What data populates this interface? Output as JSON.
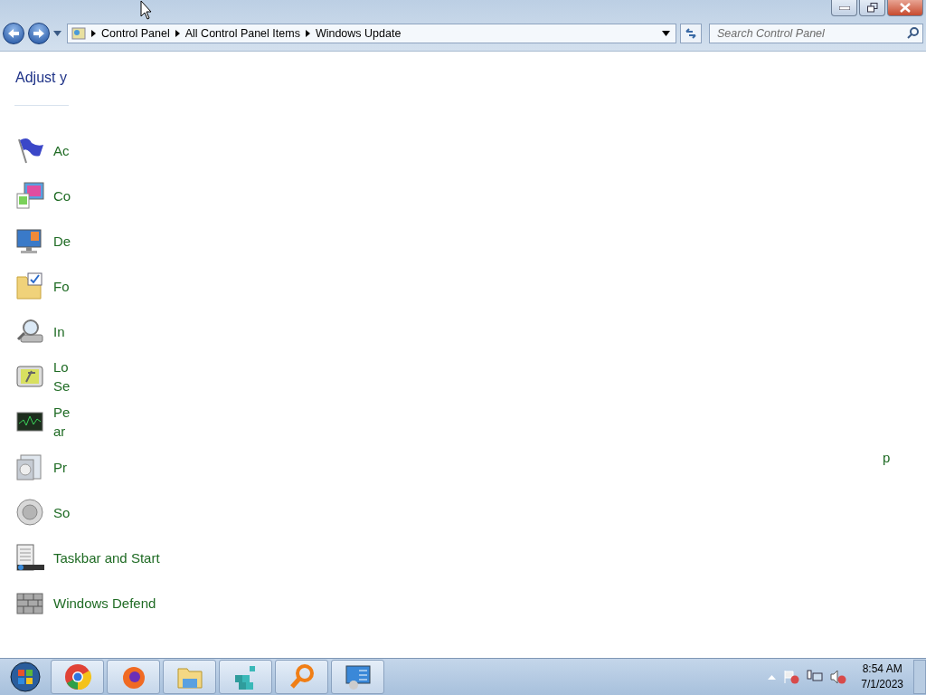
{
  "address_bar": {
    "crumbs": [
      "Control Panel",
      "All Control Panel Items",
      "Windows Update"
    ]
  },
  "search": {
    "placeholder": "Search Control Panel"
  },
  "heading": "Adjust y",
  "items": [
    {
      "kind": "flag",
      "lines": [
        "Ac"
      ]
    },
    {
      "kind": "color",
      "lines": [
        "Co"
      ]
    },
    {
      "kind": "display",
      "lines": [
        "De"
      ]
    },
    {
      "kind": "folder",
      "lines": [
        "Fo"
      ]
    },
    {
      "kind": "indexing",
      "lines": [
        "In"
      ]
    },
    {
      "kind": "location",
      "lines": [
        "Lo",
        "Se"
      ]
    },
    {
      "kind": "performance",
      "lines": [
        "Pe",
        "ar"
      ]
    },
    {
      "kind": "programs",
      "lines": [
        "Pr"
      ]
    },
    {
      "kind": "sound",
      "lines": [
        "So"
      ]
    },
    {
      "kind": "taskbar",
      "lines": [
        "Taskbar and Start"
      ]
    },
    {
      "kind": "firewall",
      "lines": [
        "Windows Defend"
      ]
    }
  ],
  "fragment": "p",
  "taskbar": {
    "apps": [
      {
        "kind": "chrome"
      },
      {
        "kind": "firefox"
      },
      {
        "kind": "explorer"
      },
      {
        "kind": "registry"
      },
      {
        "kind": "search"
      },
      {
        "kind": "panel"
      }
    ]
  },
  "clock": {
    "time": "8:54 AM",
    "date": "7/1/2023"
  }
}
